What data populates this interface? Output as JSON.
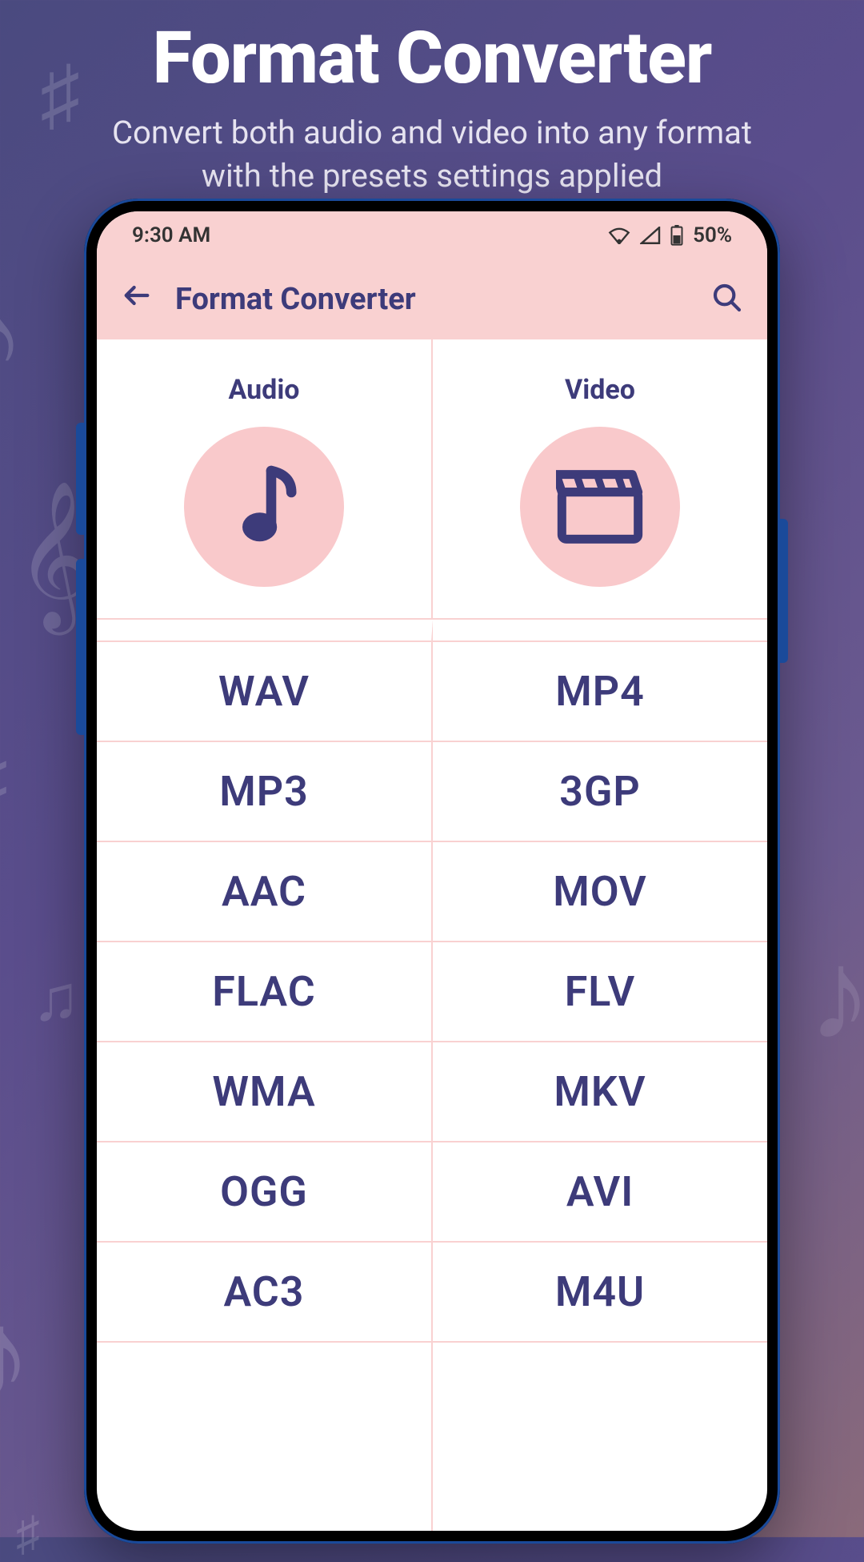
{
  "hero": {
    "title": "Format Converter",
    "subtitle": "Convert both audio and video into any format with the presets settings applied"
  },
  "status": {
    "time": "9:30 AM",
    "battery": "50%"
  },
  "appbar": {
    "title": "Format Converter"
  },
  "categories": {
    "audio_label": "Audio",
    "video_label": "Video"
  },
  "formats": {
    "audio": [
      "WAV",
      "MP3",
      "AAC",
      "FLAC",
      "WMA",
      "OGG",
      "AC3"
    ],
    "video": [
      "MP4",
      "3GP",
      "MOV",
      "FLV",
      "MKV",
      "AVI",
      "M4U"
    ]
  },
  "colors": {
    "accent": "#3d3b7a",
    "surface_pink": "#f9d1d1",
    "circle_pink": "#f9c9cb"
  }
}
